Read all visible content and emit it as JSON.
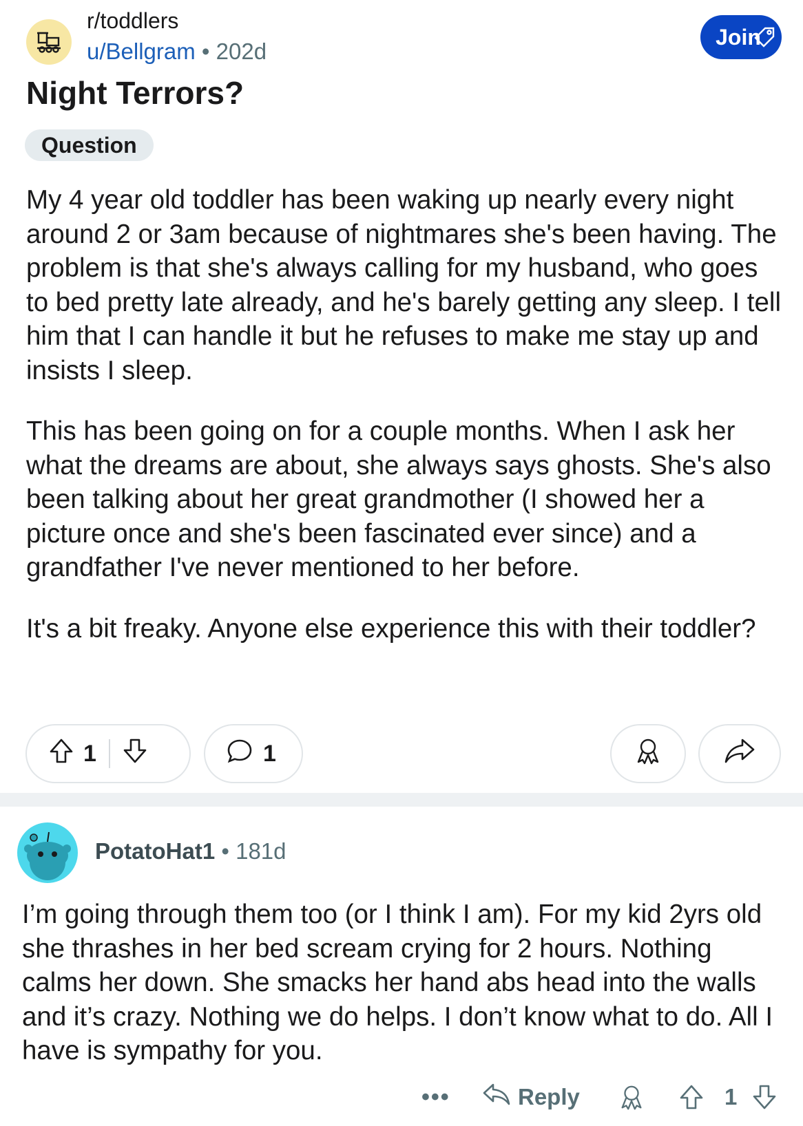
{
  "post": {
    "subreddit": "r/toddlers",
    "author": "u/Bellgram",
    "separator": "•",
    "age": "202d",
    "join_label": "Join",
    "title": "Night Terrors?",
    "flair": "Question",
    "paragraphs": [
      "My 4 year old toddler has been waking up nearly every night around 2 or 3am because of nightmares she's been having. The problem is that she's always calling for my husband, who goes to bed pretty late already, and he's barely getting any sleep. I tell him that I can handle it but he refuses to make me stay up and insists I sleep.",
      "This has been going on for a couple months. When I ask her what the dreams are about, she always says ghosts. She's also been talking about her great grandmother (I showed her a picture once and she's been fascinated ever since) and a grandfather I've never mentioned to her before.",
      "It's a bit freaky. Anyone else experience this with their toddler?"
    ],
    "upvotes": "1",
    "comments": "1",
    "icons": {
      "subreddit": "toy-train-icon",
      "join_tag": "tag-icon",
      "upvote": "arrow-up-icon",
      "downvote": "arrow-down-icon",
      "comment": "speech-bubble-icon",
      "award": "award-icon",
      "share": "share-arrow-icon"
    }
  },
  "comment": {
    "author": "PotatoHat1",
    "separator": "•",
    "age": "181d",
    "text": "I’m going through them too (or I think I am). For my kid 2yrs old she thrashes in her bed scream crying for 2 hours. Nothing calms her down. She smacks her hand abs head into the walls and it’s crazy. Nothing we do helps. I don’t know what to do. All I have is sympathy for you.",
    "more": "•••",
    "reply_label": "Reply",
    "score": "1",
    "icons": {
      "avatar": "snoo-avatar-icon",
      "reply": "reply-arrow-icon",
      "award": "award-icon",
      "upvote": "arrow-up-icon",
      "downvote": "arrow-down-icon"
    }
  },
  "colors": {
    "accent": "#0a45c4",
    "user_link": "#1c5fb8",
    "meta": "#576f76",
    "flair_bg": "#e5ebee",
    "sub_avatar_bg": "#f7e7a4",
    "user_avatar_bg": "#4dd8ec"
  }
}
